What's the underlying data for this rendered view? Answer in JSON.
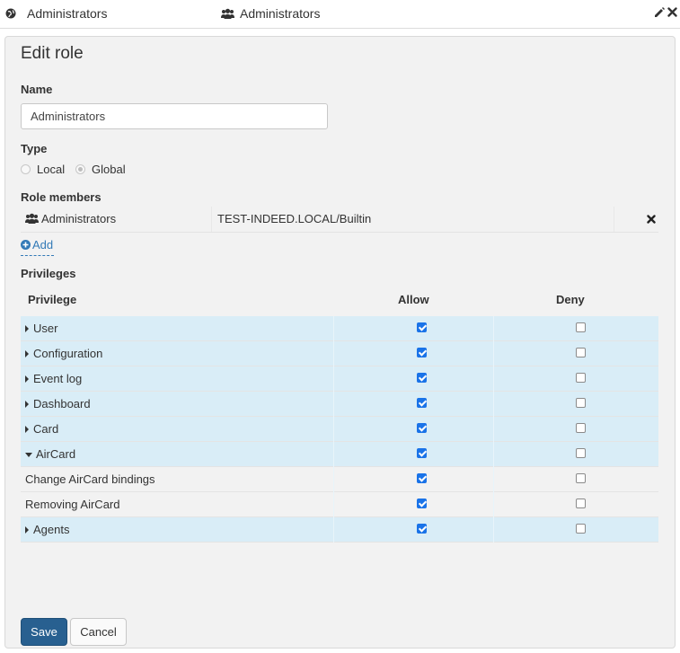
{
  "topbar": {
    "left_title": "Administrators",
    "center_title": "Administrators",
    "icons": [
      "globe-icon",
      "users-icon",
      "pencil-icon",
      "close-icon"
    ]
  },
  "form": {
    "title": "Edit role",
    "name_label": "Name",
    "name_value": "Administrators",
    "type_label": "Type",
    "type_options": [
      {
        "label": "Local",
        "selected": false
      },
      {
        "label": "Global",
        "selected": true
      }
    ],
    "members_label": "Role members",
    "members": [
      {
        "name": "Administrators",
        "domain": "TEST-INDEED.LOCAL/Builtin",
        "icon": "users-icon"
      }
    ],
    "add_label": "Add",
    "privileges_label": "Privileges",
    "columns": {
      "privilege": "Privilege",
      "allow": "Allow",
      "deny": "Deny"
    },
    "privileges": [
      {
        "label": "User",
        "allow": true,
        "deny": false,
        "kind": "group",
        "expanded": false
      },
      {
        "label": "Configuration",
        "allow": true,
        "deny": false,
        "kind": "group",
        "expanded": false
      },
      {
        "label": "Event log",
        "allow": true,
        "deny": false,
        "kind": "group",
        "expanded": false
      },
      {
        "label": "Dashboard",
        "allow": true,
        "deny": false,
        "kind": "group",
        "expanded": false
      },
      {
        "label": "Card",
        "allow": true,
        "deny": false,
        "kind": "group",
        "expanded": false
      },
      {
        "label": "AirCard",
        "allow": true,
        "deny": false,
        "kind": "group",
        "expanded": true
      },
      {
        "label": "Change AirCard bindings",
        "allow": true,
        "deny": false,
        "kind": "child",
        "expanded": false
      },
      {
        "label": "Removing AirCard",
        "allow": true,
        "deny": false,
        "kind": "child",
        "expanded": false
      },
      {
        "label": "Agents",
        "allow": true,
        "deny": false,
        "kind": "group",
        "expanded": false
      }
    ],
    "save_label": "Save",
    "cancel_label": "Cancel"
  },
  "colors": {
    "accent": "#337ab7",
    "primary_button": "#286090",
    "group_row_bg": "#d9edf7",
    "checkbox_on": "#1a73e8"
  }
}
